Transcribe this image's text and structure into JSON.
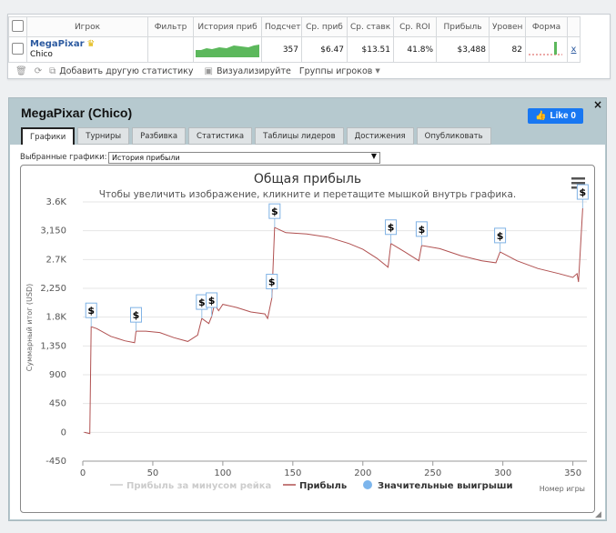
{
  "top_table": {
    "headers": [
      "",
      "Игрок",
      "Фильтр",
      "История приб",
      "Подсчет",
      "Ср. приб",
      "Ср. ставк",
      "Ср. ROI",
      "Прибыль",
      "Уровен",
      "Форма",
      ""
    ],
    "row": {
      "player": "MegaPixar",
      "site": "Chico",
      "count": "357",
      "avg_profit": "$6.47",
      "avg_stake": "$13.51",
      "roi": "41.8%",
      "profit": "$3,488",
      "level": "82",
      "remove": "x"
    }
  },
  "toolbar": {
    "add_stat": "Добавить другую статистику",
    "visualize": "Визуализируйте",
    "groups": "Группы игроков"
  },
  "panel": {
    "title": "MegaPixar (Chico)",
    "like": "Like 0",
    "close": "×"
  },
  "tabs": [
    "Графики",
    "Турниры",
    "Разбивка",
    "Статистика",
    "Таблицы лидеров",
    "Достижения",
    "Опубликовать"
  ],
  "chart_selector": {
    "label": "Выбранные графики:",
    "value": "История прибыли"
  },
  "chart_data": {
    "type": "line",
    "title": "Общая прибыль",
    "subtitle": "Чтобы увеличить изображение, кликните и перетащите мышкой внутрь графика.",
    "xlabel": "Номер игры",
    "ylabel": "Суммарный итог (USD)",
    "xlim": [
      0,
      360
    ],
    "ylim": [
      -450,
      3600
    ],
    "x_ticks": [
      0,
      50,
      100,
      150,
      200,
      250,
      300,
      350
    ],
    "y_ticks": [
      -450,
      0,
      450,
      900,
      1350,
      1800,
      2250,
      2700,
      3150,
      3600
    ],
    "y_tick_labels": [
      "-450",
      "0",
      "450",
      "900",
      "1,350",
      "1.8K",
      "2,250",
      "2.7K",
      "3,150",
      "3.6K"
    ],
    "legend": [
      "Прибыль за минусом рейка",
      "Прибыль",
      "Значительные выигрыши"
    ],
    "legend_position": "bottom",
    "grid": true,
    "line_color": "#b05050",
    "series": [
      {
        "name": "Прибыль",
        "points": [
          [
            1,
            0
          ],
          [
            5,
            -20
          ],
          [
            6,
            1650
          ],
          [
            10,
            1620
          ],
          [
            20,
            1500
          ],
          [
            30,
            1430
          ],
          [
            37,
            1400
          ],
          [
            38,
            1580
          ],
          [
            45,
            1580
          ],
          [
            55,
            1560
          ],
          [
            65,
            1480
          ],
          [
            75,
            1420
          ],
          [
            82,
            1520
          ],
          [
            85,
            1780
          ],
          [
            90,
            1700
          ],
          [
            92,
            1810
          ],
          [
            94,
            2000
          ],
          [
            97,
            1900
          ],
          [
            100,
            2000
          ],
          [
            110,
            1950
          ],
          [
            120,
            1880
          ],
          [
            130,
            1850
          ],
          [
            132,
            1780
          ],
          [
            135,
            2100
          ],
          [
            137,
            3200
          ],
          [
            145,
            3120
          ],
          [
            160,
            3100
          ],
          [
            175,
            3050
          ],
          [
            190,
            2950
          ],
          [
            200,
            2860
          ],
          [
            210,
            2720
          ],
          [
            218,
            2580
          ],
          [
            220,
            2950
          ],
          [
            230,
            2820
          ],
          [
            240,
            2680
          ],
          [
            242,
            2920
          ],
          [
            255,
            2870
          ],
          [
            270,
            2760
          ],
          [
            285,
            2680
          ],
          [
            295,
            2650
          ],
          [
            298,
            2820
          ],
          [
            310,
            2680
          ],
          [
            325,
            2560
          ],
          [
            340,
            2480
          ],
          [
            350,
            2420
          ],
          [
            353,
            2480
          ],
          [
            354,
            2350
          ],
          [
            357,
            3500
          ]
        ]
      }
    ],
    "big_wins_x": [
      6,
      38,
      85,
      92,
      135,
      137,
      220,
      242,
      298,
      357
    ],
    "big_win_marker": "$"
  },
  "colors": {
    "panel_header": "#b6c9cf",
    "like_button": "#1877f2",
    "player_link": "#2c5aa0",
    "spark_fill": "#5cb85c"
  }
}
